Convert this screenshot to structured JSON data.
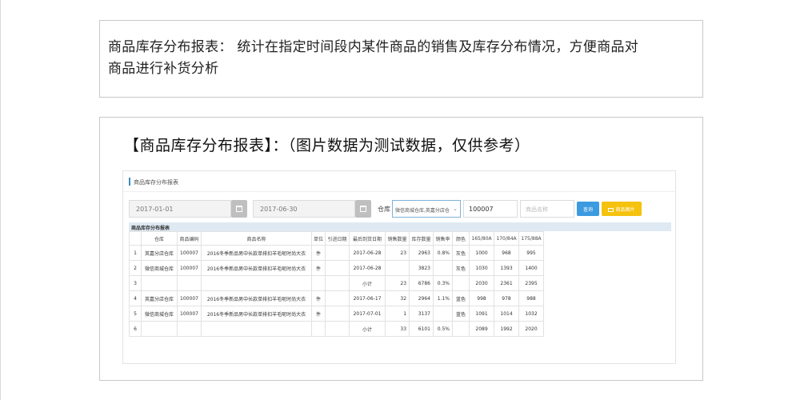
{
  "description": {
    "line1": "商品库存分布报表： 统计在指定时间段内某件商品的销售及库存分布情况，方便商品对",
    "line2": "商品进行补货分析"
  },
  "demo": {
    "title": "【商品库存分布报表】：（图片数据为测试数据，仅供参考）"
  },
  "panel": {
    "header": "商品库存分布报表",
    "start_date": "2017-01-01",
    "end_date": "2017-06-30",
    "warehouse_label": "仓库",
    "warehouse_value": "微信商城仓库,英嘉分店仓",
    "product_code": "100007",
    "product_name_placeholder": "商品名称",
    "query_button": "查询",
    "image_button": "商品图片"
  },
  "table": {
    "caption": "商品库存分布报表",
    "headers": [
      "",
      "仓库",
      "商品编码",
      "商品名称",
      "单位",
      "引进日期",
      "最后到货日期",
      "销售数量",
      "库存数量",
      "销售率",
      "颜色",
      "165/80A",
      "170/84A",
      "175/88A"
    ],
    "rows": [
      [
        "1",
        "英嘉分店仓库",
        "100007",
        "2016冬季新品男中长款单排扣羊毛呢时尚大衣",
        "件",
        "",
        "2017-06-28",
        "23",
        "2963",
        "0.8%",
        "灰色",
        "1000",
        "968",
        "995"
      ],
      [
        "2",
        "微信商城仓库",
        "100007",
        "2016冬季新品男中长款单排扣羊毛呢时尚大衣",
        "件",
        "",
        "2017-06-28",
        "",
        "3823",
        "",
        "灰色",
        "1030",
        "1393",
        "1400"
      ],
      [
        "3",
        "",
        "",
        "",
        "",
        "",
        "小计",
        "23",
        "6786",
        "0.3%",
        "",
        "2030",
        "2361",
        "2395"
      ],
      [
        "4",
        "英嘉分店仓库",
        "100007",
        "2016冬季新品男中长款单排扣羊毛呢时尚大衣",
        "件",
        "",
        "2017-06-17",
        "32",
        "2964",
        "1.1%",
        "蓝色",
        "998",
        "978",
        "988"
      ],
      [
        "5",
        "微信商城仓库",
        "100007",
        "2016冬季新品男中长款单排扣羊毛呢时尚大衣",
        "件",
        "",
        "2017-07-01",
        "1",
        "3137",
        "",
        "蓝色",
        "1091",
        "1014",
        "1032"
      ],
      [
        "6",
        "",
        "",
        "",
        "",
        "",
        "小计",
        "33",
        "6101",
        "0.5%",
        "",
        "2089",
        "1992",
        "2020"
      ]
    ]
  },
  "colors": {
    "accent": "#3c8dbc",
    "query_button": "#3c9ae0",
    "image_button": "#f5c20f",
    "caption_bg": "#dfe9f3"
  }
}
